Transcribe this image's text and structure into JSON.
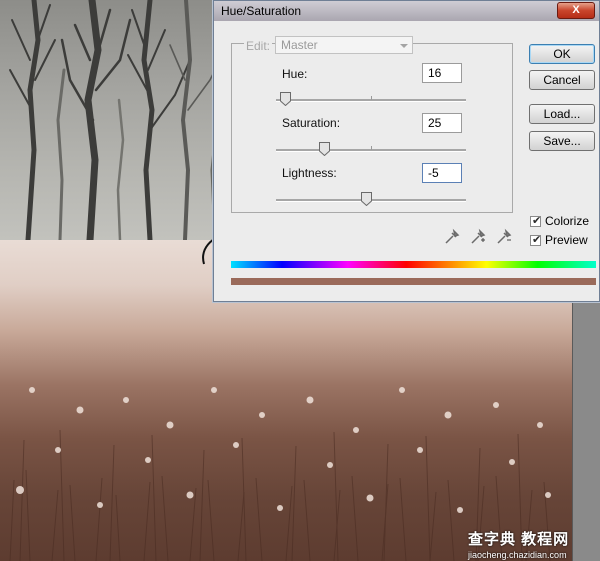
{
  "dialog": {
    "title": "Hue/Saturation",
    "close_label": "X",
    "edit_label": "Edit:",
    "edit_value": "Master",
    "hue": {
      "label": "Hue:",
      "value": "16"
    },
    "saturation": {
      "label": "Saturation:",
      "value": "25"
    },
    "lightness": {
      "label": "Lightness:",
      "value": "-5"
    },
    "buttons": {
      "ok": "OK",
      "cancel": "Cancel",
      "load": "Load...",
      "save": "Save..."
    },
    "checkboxes": {
      "colorize": "Colorize",
      "preview": "Preview",
      "colorize_checked": true,
      "preview_checked": true
    },
    "result_color": "#9a6a5a"
  },
  "watermark": {
    "line1": "查字典 教程网",
    "line2": "jiaocheng.chazidian.com"
  }
}
